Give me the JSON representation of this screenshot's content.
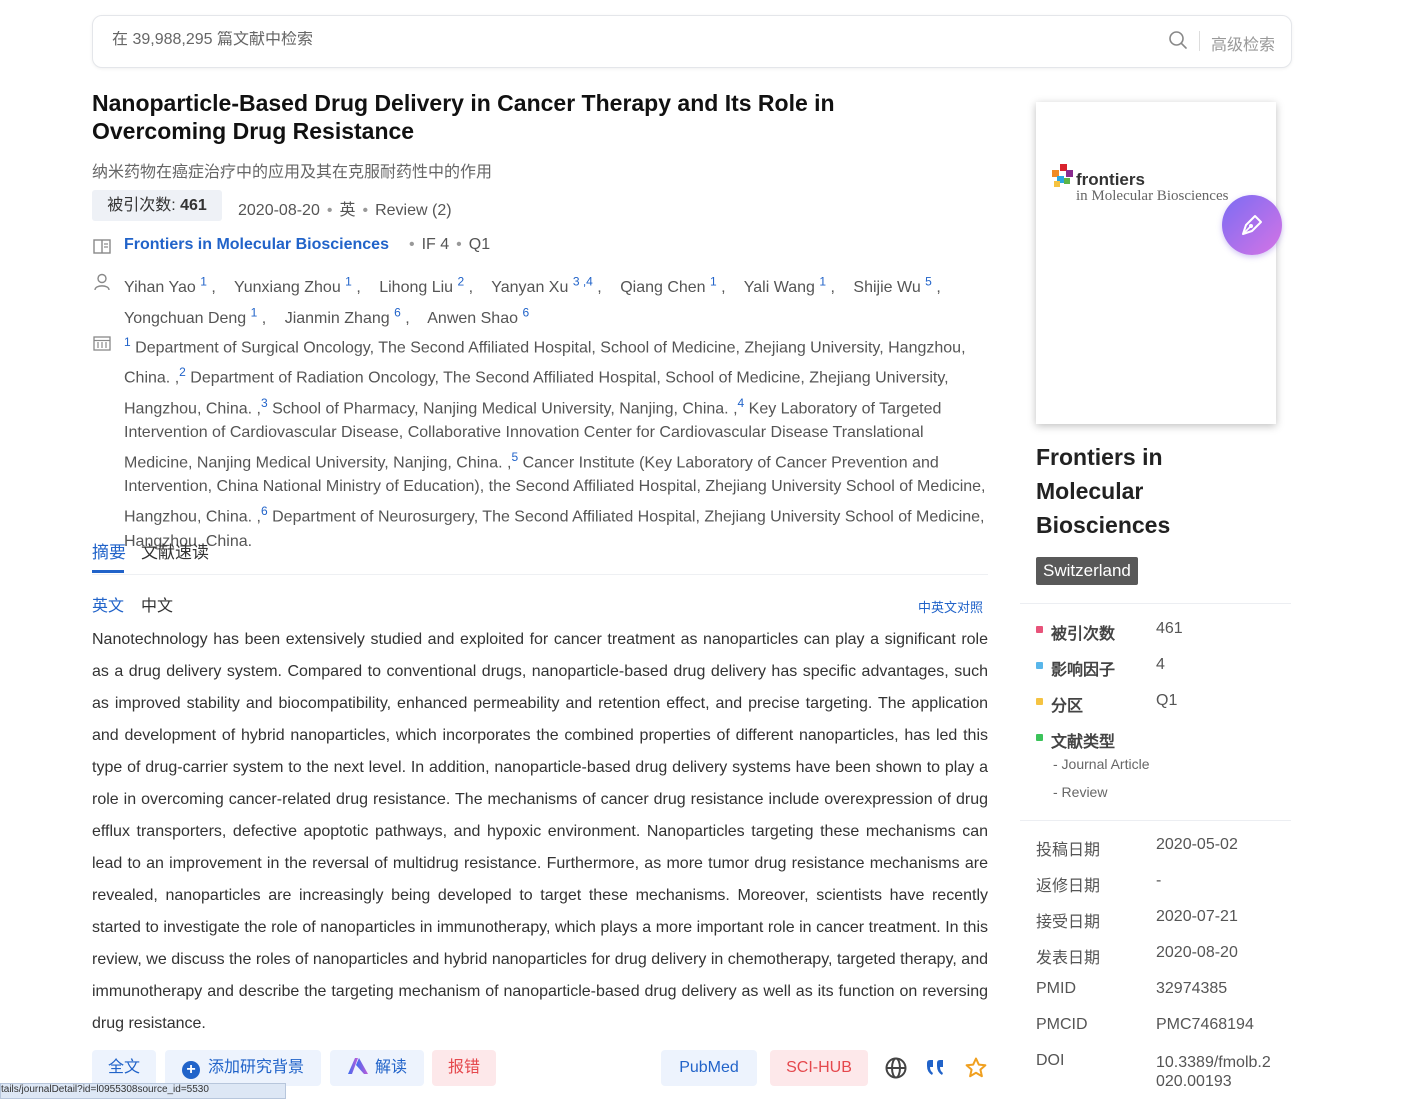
{
  "search": {
    "placeholder": "在 39,988,295 篇文献中检索",
    "advanced": "高级检索"
  },
  "article": {
    "title_en": "Nanoparticle-Based Drug Delivery in Cancer Therapy and Its Role in Overcoming Drug Resistance",
    "title_zh": "纳米药物在癌症治疗中的应用及其在克服耐药性中的作用",
    "cite_label": "被引次数: ",
    "cite_count": "461",
    "date": "2020-08-20",
    "language": "英",
    "type": "Review (2)",
    "journal": "Frontiers in Molecular Biosciences",
    "if": "IF 4",
    "quartile": "Q1"
  },
  "authors": [
    {
      "name": "Yihan Yao",
      "sup": "1",
      "sep": ","
    },
    {
      "name": "Yunxiang Zhou",
      "sup": "1",
      "sep": ","
    },
    {
      "name": "Lihong Liu",
      "sup": "2",
      "sep": ","
    },
    {
      "name": "Yanyan Xu",
      "sup": "3 ,4",
      "sep": ","
    },
    {
      "name": "Qiang Chen",
      "sup": "1",
      "sep": ","
    },
    {
      "name": "Yali Wang",
      "sup": "1",
      "sep": ","
    },
    {
      "name": "Shijie Wu",
      "sup": "5",
      "sep": ","
    },
    {
      "name": "Yongchuan Deng",
      "sup": "1",
      "sep": ","
    },
    {
      "name": "Jianmin Zhang",
      "sup": "6",
      "sep": ","
    },
    {
      "name": "Anwen Shao",
      "sup": "6",
      "sep": ""
    }
  ],
  "affiliations": [
    {
      "sup": "1",
      "text": " Department of Surgical Oncology, The Second Affiliated Hospital, School of Medicine, Zhejiang University, Hangzhou, China. ,"
    },
    {
      "sup": "2",
      "text": " Department of Radiation Oncology, The Second Affiliated Hospital, School of Medicine, Zhejiang University, Hangzhou, China. ,"
    },
    {
      "sup": "3",
      "text": " School of Pharmacy, Nanjing Medical University, Nanjing, China. ,"
    },
    {
      "sup": "4",
      "text": " Key Laboratory of Targeted Intervention of Cardiovascular Disease, Collaborative Innovation Center for Cardiovascular Disease Translational Medicine, Nanjing Medical University, Nanjing, China. ,"
    },
    {
      "sup": "5",
      "text": " Cancer Institute (Key Laboratory of Cancer Prevention and Intervention, China National Ministry of Education), the Second Affiliated Hospital, Zhejiang University School of Medicine, Hangzhou, China. ,"
    },
    {
      "sup": "6",
      "text": " Department of Neurosurgery, The Second Affiliated Hospital, Zhejiang University School of Medicine, Hangzhou, China."
    }
  ],
  "tabs": {
    "abstract": "摘要",
    "quick_read": "文献速读"
  },
  "lang": {
    "en": "英文",
    "zh": "中文",
    "compare": "中英文对照"
  },
  "abstract": "Nanotechnology has been extensively studied and exploited for cancer treatment as nanoparticles can play a significant role as a drug delivery system. Compared to conventional drugs, nanoparticle-based drug delivery has specific advantages, such as improved stability and biocompatibility, enhanced permeability and retention effect, and precise targeting. The application and development of hybrid nanoparticles, which incorporates the combined properties of different nanoparticles, has led this type of drug-carrier system to the next level. In addition, nanoparticle-based drug delivery systems have been shown to play a role in overcoming cancer-related drug resistance. The mechanisms of cancer drug resistance include overexpression of drug efflux transporters, defective apoptotic pathways, and hypoxic environment. Nanoparticles targeting these mechanisms can lead to an improvement in the reversal of multidrug resistance. Furthermore, as more tumor drug resistance mechanisms are revealed, nanoparticles are increasingly being developed to target these mechanisms. Moreover, scientists have recently started to investigate the role of nanoparticles in immunotherapy, which plays a more important role in cancer treatment. In this review, we discuss the roles of nanoparticles and hybrid nanoparticles for drug delivery in chemotherapy, targeted therapy, and immunotherapy and describe the targeting mechanism of nanoparticle-based drug delivery as well as its function on reversing drug resistance.",
  "buttons": {
    "fulltext": "全文",
    "add_background": "添加研究背景",
    "interpret": "解读",
    "report_error": "报错",
    "pubmed": "PubMed",
    "scihub": "SCI-HUB"
  },
  "status_url": "tails/journalDetail?id=l0955308source_id=5530",
  "sidebar": {
    "cover_name": "frontiers",
    "cover_sub": "in Molecular Biosciences",
    "journal_title": "Frontiers in Molecular Biosciences",
    "country": "Switzerland",
    "stats": [
      {
        "label": "被引次数",
        "value": "461",
        "color": "#e8537a"
      },
      {
        "label": "影响因子",
        "value": "4",
        "color": "#58b6ea"
      },
      {
        "label": "分区",
        "value": "Q1",
        "color": "#f5c342"
      },
      {
        "label": "文献类型",
        "value": "",
        "color": "#3bc35a"
      }
    ],
    "doc_types": [
      "- Journal Article",
      "- Review"
    ],
    "dates": [
      {
        "label": "投稿日期",
        "value": "2020-05-02"
      },
      {
        "label": "返修日期",
        "value": "-"
      },
      {
        "label": "接受日期",
        "value": "2020-07-21"
      },
      {
        "label": "发表日期",
        "value": "2020-08-20"
      },
      {
        "label": "PMID",
        "value": "32974385"
      },
      {
        "label": "PMCID",
        "value": "PMC7468194"
      },
      {
        "label": "DOI",
        "value": "10.3389/fmolb.2020.00193"
      }
    ]
  }
}
